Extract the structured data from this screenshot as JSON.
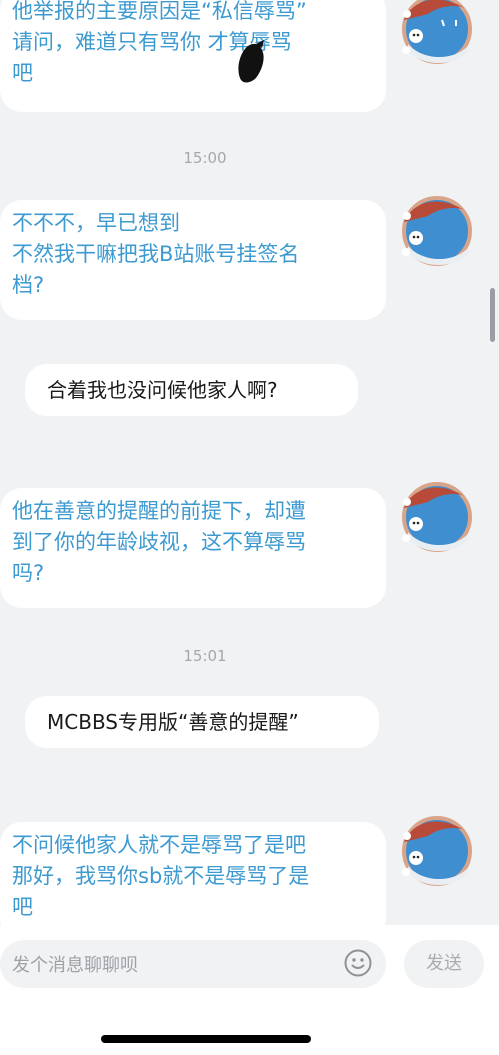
{
  "messages": [
    {
      "lines": [
        "他举报的主要原因是“私信辱骂”",
        "请问，难道只有骂你      才算辱骂",
        "吧"
      ]
    },
    {
      "lines": [
        "不不不，早已想到",
        "不然我干嘛把我B站账号挂签名",
        "档?"
      ]
    },
    {
      "text": "合着我也没问候他家人啊?"
    },
    {
      "lines": [
        "他在善意的提醒的前提下，却遭",
        "到了你的年龄歧视，这不算辱骂",
        "吗?"
      ]
    },
    {
      "text": "MCBBS专用版“善意的提醒”"
    },
    {
      "lines": [
        "不问候他家人就不是辱骂了是吧",
        "那好，我骂你sb就不是辱骂了是",
        "吧"
      ]
    }
  ],
  "timestamps": [
    "15:00",
    "15:01"
  ],
  "input": {
    "placeholder": "发个消息聊聊呗",
    "value": ""
  },
  "send_label": "发送",
  "icons": {
    "emoji": "smiley-face-icon"
  },
  "colors": {
    "my_text": "#3d9ad1",
    "peer_text": "#1a1a1a",
    "bg": "#f1f2f4"
  }
}
